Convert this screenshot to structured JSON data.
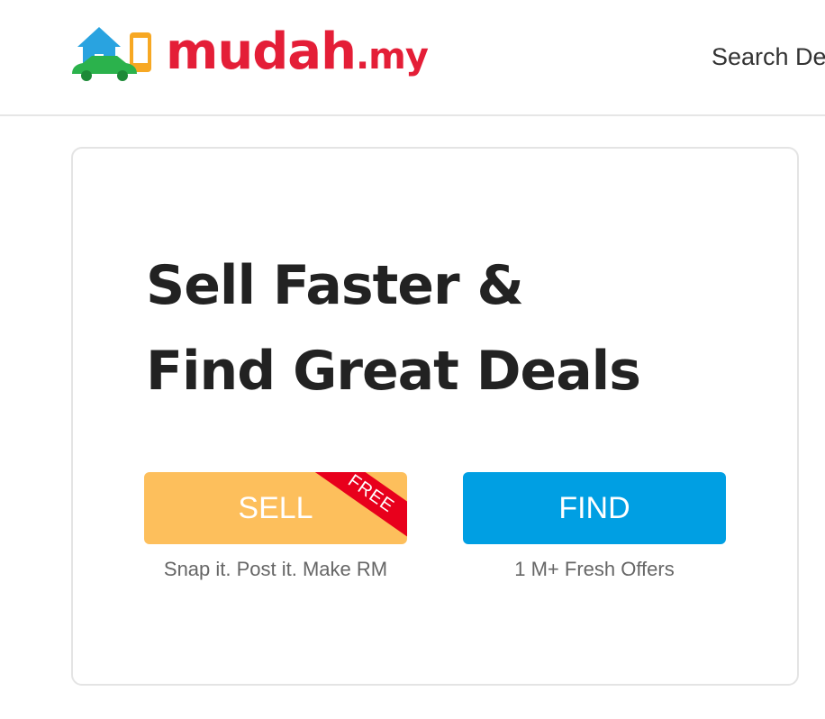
{
  "header": {
    "logo": {
      "brand": "mudah",
      "dot": ".",
      "tld": "my"
    },
    "nav_search_label": "Search De"
  },
  "hero": {
    "headline_line1": "Sell Faster &",
    "headline_line2": "Find Great Deals",
    "sell": {
      "label": "SELL",
      "badge": "FREE",
      "subtitle": "Snap it. Post it. Make RM",
      "color": "#fdbf5c"
    },
    "find": {
      "label": "FIND",
      "subtitle": "1 M+ Fresh Offers",
      "color": "#009fe3"
    }
  },
  "colors": {
    "brand_red": "#e41e37",
    "badge_red": "#e8001c",
    "text_dark": "#222222",
    "text_muted": "#666666"
  }
}
